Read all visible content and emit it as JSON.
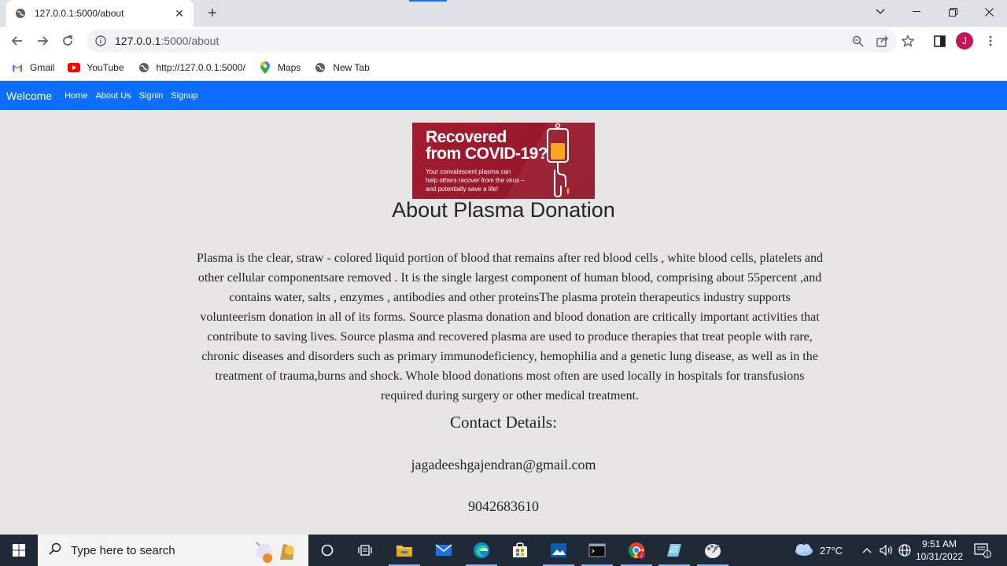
{
  "browser": {
    "tab_title": "127.0.0.1:5000/about",
    "url_host": "127.0.0.1",
    "url_path": ":5000/about",
    "profile_initial": "J",
    "bookmarks": [
      {
        "label": "Gmail",
        "icon": "gmail-icon"
      },
      {
        "label": "YouTube",
        "icon": "youtube-icon"
      },
      {
        "label": "http://127.0.0.1:5000/",
        "icon": "globe-icon"
      },
      {
        "label": "Maps",
        "icon": "maps-icon"
      },
      {
        "label": "New Tab",
        "icon": "globe-icon"
      }
    ]
  },
  "navbar": {
    "brand": "Welcome",
    "links": [
      "Home",
      "About Us",
      "Signin",
      "Signup"
    ],
    "color": "#0d6efd"
  },
  "banner": {
    "headline_1": "Recovered",
    "headline_2": "from COVID-19?",
    "sub_1": "Your convalescent plasma can",
    "sub_2": "help others recover from the virus –",
    "sub_3": "and potentially save a life!"
  },
  "main": {
    "title": "About Plasma Donation",
    "paragraph": "Plasma is the clear, straw - colored liquid portion of blood that remains after red blood cells , white blood cells, platelets and other cellular componentsare removed . It is the single largest component of human blood, comprising about 55percent ,and contains water, salts , enzymes , antibodies and other proteinsThe plasma protein therapeutics industry supports volunteerism donation in all of its forms. Source plasma donation and blood donation are critically important activities that contribute to saving lives. Source plasma and recovered plasma are used to produce therapies that treat people with rare, chronic diseases and disorders such as primary immunodeficiency, hemophilia and a genetic lung disease, as well as in the treatment of trauma,burns and shock. Whole blood donations most often are used locally in hospitals for transfusions required during surgery or other medical treatment.",
    "contact_title": "Contact Details:",
    "email": "jagadeeshgajendran@gmail.com",
    "phone": "9042683610"
  },
  "taskbar": {
    "search_placeholder": "Type here to search",
    "temperature": "27°C",
    "time": "9:51 AM",
    "date": "10/31/2022",
    "notification_count": "1"
  }
}
